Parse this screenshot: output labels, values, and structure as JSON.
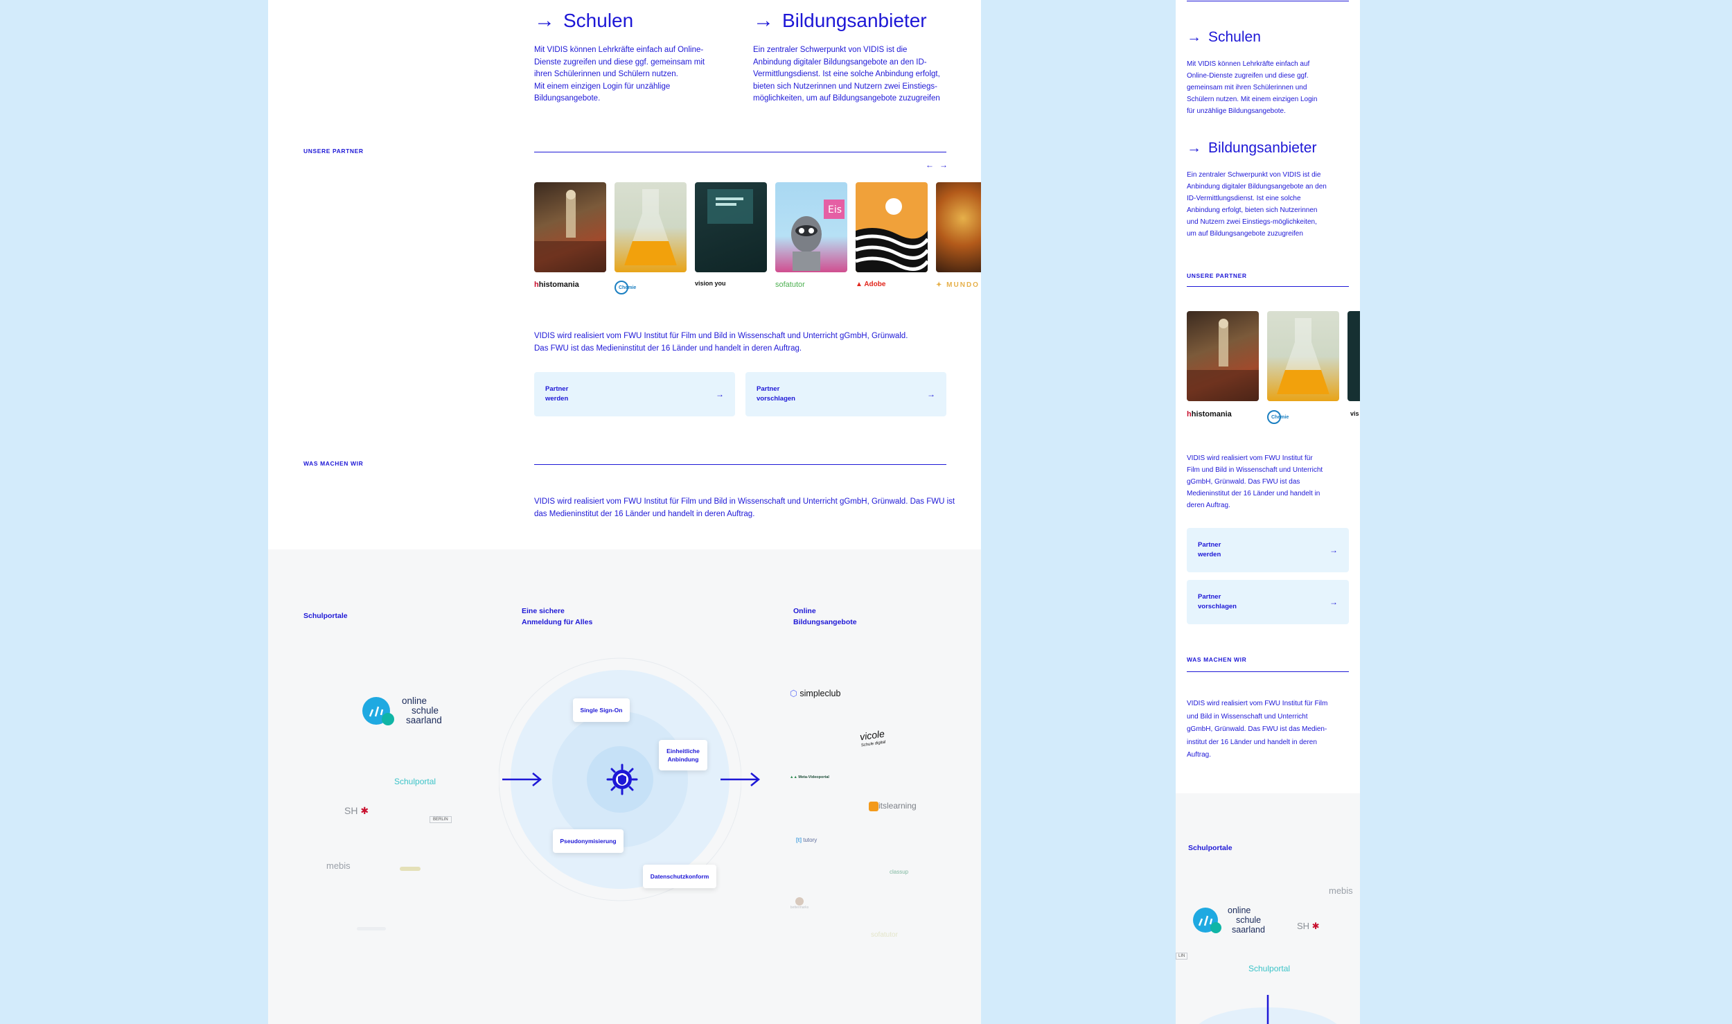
{
  "colors": {
    "accent": "#1d17d6",
    "page_bg": "#d3ebfb",
    "card_bg": "#e6f4fd",
    "gray_bg": "#f6f7f8"
  },
  "desktop": {
    "schulen": {
      "title": "Schulen",
      "text": [
        "Mit VIDIS können Lehrkräfte einfach auf Online-",
        "Dienste zugreifen und diese ggf. gemeinsam mit",
        "ihren Schülerinnen und Schülern nutzen.",
        "Mit einem einzigen Login für unzählige",
        "Bildungsangebote."
      ]
    },
    "anbieter": {
      "title": "Bildungsanbieter",
      "text": [
        "Ein zentraler Schwerpunkt von VIDIS ist die",
        "Anbindung digitaler Bildungsangebote an den ID-",
        "Vermittlungsdienst. Ist eine solche Anbindung erfolgt,",
        "bieten sich Nutzerinnen und Nutzern zwei Einstiegs-",
        "möglichkeiten, um auf Bildungsangebote zuzugreifen"
      ]
    },
    "partner_label": "UNSERE PARTNER",
    "carousel_prev": "←",
    "carousel_next": "→",
    "partners": [
      "histomania",
      "Chemie",
      "vision you",
      "sofatutor",
      "Adobe",
      "MUNDO"
    ],
    "fwu_text": [
      "VIDIS wird realisiert vom FWU Institut für Film und Bild in Wissenschaft und Unterricht gGmbH, Grünwald.",
      "Das FWU ist das Medieninstitut der 16 Länder und handelt in deren Auftrag."
    ],
    "btn_partner_werden": [
      "Partner",
      "werden"
    ],
    "btn_partner_vorschlagen": [
      "Partner",
      "vorschlagen"
    ],
    "btn_arrow": "→",
    "was_label": "WAS MACHEN WIR",
    "was_text": [
      "VIDIS wird realisiert vom FWU Institut für Film und Bild in Wissenschaft und Unterricht gGmbH, Grünwald. Das FWU ist",
      "das Medieninstitut der 16 Länder und handelt in deren Auftrag."
    ],
    "diagram": {
      "col1": "Schulportale",
      "col2": [
        "Eine sichere",
        "Anmeldung für Alles"
      ],
      "col3": [
        "Online",
        "Bildungsangebote"
      ],
      "chips": {
        "sso": "Single Sign-On",
        "anbindung": [
          "Einheitliche",
          "Anbindung"
        ],
        "pseudo": "Pseudonymisierung",
        "datenschutz": "Datenschutzkonform"
      },
      "portals": {
        "oss": [
          "online",
          "schule",
          "saarland"
        ],
        "schulportal": "Schulportal",
        "sh": "SH",
        "berlin": "BERLIN",
        "mebis": "mebis"
      },
      "providers": {
        "simpleclub": "simpleclub",
        "vicole": "vicole",
        "vicole_sub": "Schule digital",
        "meta": "Meta-Videoportal",
        "itslearning": "itslearning",
        "bettermarks": "bettermarks",
        "tutory": "tutory",
        "classup": "classup",
        "sofatutor": "sofatutor"
      }
    }
  },
  "mobile": {
    "schulen": {
      "title": "Schulen",
      "text": [
        "Mit VIDIS können Lehrkräfte einfach auf",
        "Online-Dienste zugreifen und diese ggf.",
        "gemeinsam mit ihren Schülerinnen und",
        "Schülern nutzen. Mit einem einzigen Login",
        "für unzählige Bildungsangebote."
      ]
    },
    "anbieter": {
      "title": "Bildungsanbieter",
      "text": [
        "Ein zentraler Schwerpunkt von VIDIS ist die",
        "Anbindung digitaler Bildungsangebote an den",
        "ID-Vermittlungsdienst. Ist eine solche",
        "Anbindung erfolgt, bieten sich Nutzerinnen",
        "und Nutzern zwei Einstiegs-möglichkeiten,",
        "um auf Bildungsangebote zuzugreifen"
      ]
    },
    "partner_label": "UNSERE PARTNER",
    "partners": [
      "histomania",
      "Chemie",
      "vis"
    ],
    "fwu_text": [
      "VIDIS wird realisiert vom FWU Institut für",
      "Film und Bild in Wissenschaft und Unterricht",
      "gGmbH, Grünwald. Das FWU ist das",
      "Medieninstitut der 16 Länder und handelt in",
      "deren Auftrag."
    ],
    "btn_partner_werden": [
      "Partner",
      "werden"
    ],
    "btn_partner_vorschlagen": [
      "Partner",
      "vorschlagen"
    ],
    "was_label": "WAS MACHEN WIR",
    "was_text": [
      "VIDIS wird realisiert vom FWU Institut für Film",
      "und Bild in Wissenschaft und Unterricht",
      "gGmbH, Grünwald. Das FWU ist das Medien-",
      "institut der 16 Länder und handelt in deren",
      "Auftrag."
    ],
    "schulportale": "Schulportale",
    "oss": [
      "online",
      "schule",
      "saarland"
    ],
    "sh": "SH",
    "mebis": "mebis",
    "schulportal": "Schulportal",
    "lin": "LIN"
  }
}
